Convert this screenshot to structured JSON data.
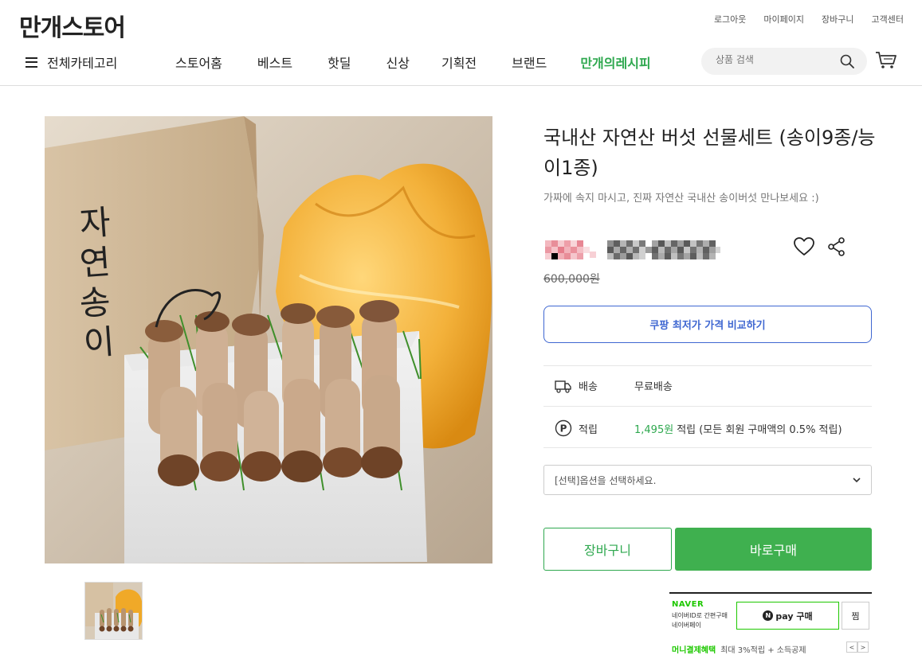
{
  "header": {
    "logo": "만개스토어",
    "util_links": [
      "로그아웃",
      "마이페이지",
      "장바구니",
      "고객센터"
    ],
    "all_categories": "전체카테고리",
    "menu": [
      "스토어홈",
      "베스트",
      "핫딜",
      "신상",
      "기획전",
      "브랜드",
      "만개의레시피"
    ],
    "search_placeholder": "상품 검색"
  },
  "product": {
    "title": "국내산 자연산 버섯 선물세트 (송이9종/능이1종)",
    "subtitle": "가짜에 속지 마시고, 진짜 자연산 국내산 송이버섯 만나보세요 :)",
    "original_price": "600,000원",
    "compare_button": "쿠팡 최저가 가격 비교하기",
    "shipping_label": "배송",
    "shipping_value": "무료배송",
    "points_label": "적립",
    "points_amount": "1,495원",
    "points_text": "적립 (모든 회원 구매액의 0.5% 적립)",
    "option_placeholder": "[선택]옵션을 선택하세요.",
    "cart_button": "장바구니",
    "buy_button": "바로구매",
    "box_text": "자연송이"
  },
  "naver_pay": {
    "brand": "NAVER",
    "desc_line1": "네이버ID로 간편구매",
    "desc_line2": "네이버페이",
    "pay_button": "pay 구매",
    "zzim": "찜",
    "benefit_label": "머니결제혜택",
    "benefit_text": "최대 3%적립 + 소득공제",
    "prev": "<",
    "next": ">"
  },
  "colors": {
    "accent_green": "#3fb04f",
    "compare_blue": "#3f67d1",
    "naver_green": "#1ec800"
  }
}
